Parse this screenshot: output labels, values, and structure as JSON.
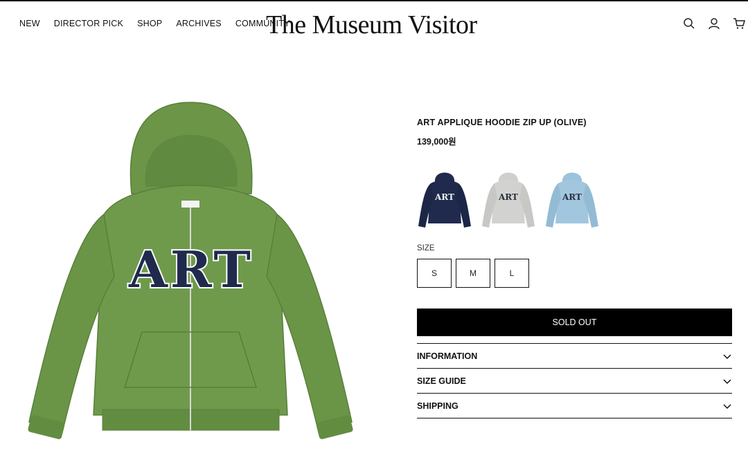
{
  "nav": {
    "items": [
      {
        "label": "NEW"
      },
      {
        "label": "DIRECTOR PICK"
      },
      {
        "label": "SHOP"
      },
      {
        "label": "ARCHIVES"
      },
      {
        "label": "COMMUNITY"
      }
    ]
  },
  "brand": {
    "logo": "The Museum Visitor"
  },
  "header_icons": [
    "search-icon",
    "account-icon",
    "cart-icon"
  ],
  "product": {
    "title": "ART APPLIQUE HOODIE ZIP UP (OLIVE)",
    "price": "139,000원",
    "image_color": "#6f9a4c",
    "applique_text": "ART",
    "colors": [
      {
        "name": "navy",
        "hex": "#1f2a4d"
      },
      {
        "name": "grey",
        "hex": "#cfd0ce"
      },
      {
        "name": "sky blue",
        "hex": "#9cc3dc"
      }
    ],
    "size_label": "SIZE",
    "sizes": [
      "S",
      "M",
      "L"
    ],
    "soldout_label": "SOLD OUT"
  },
  "accordion": [
    {
      "label": "INFORMATION"
    },
    {
      "label": "SIZE GUIDE"
    },
    {
      "label": "SHIPPING"
    }
  ]
}
